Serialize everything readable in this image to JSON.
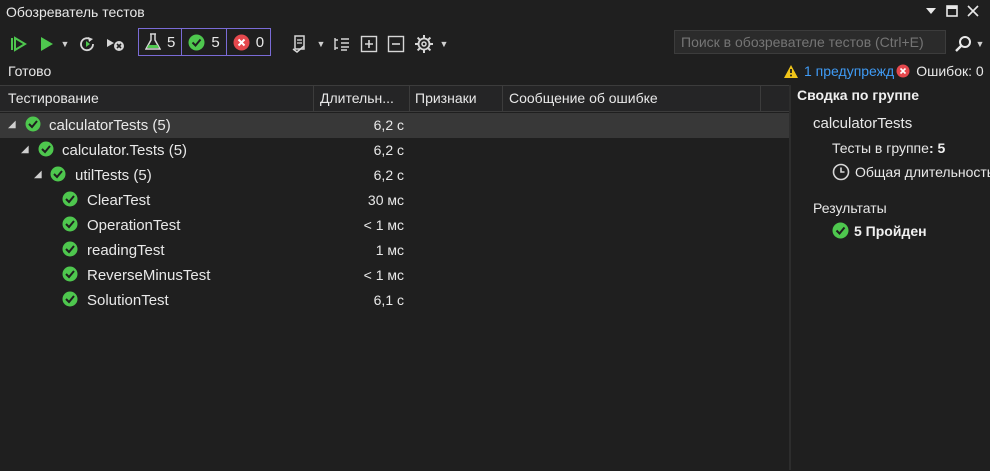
{
  "window": {
    "title": "Обозреватель тестов"
  },
  "toolbar": {
    "counters": {
      "total": "5",
      "passed": "5",
      "failed": "0"
    },
    "search_placeholder": "Поиск в обозревателе тестов (Ctrl+E)"
  },
  "status": {
    "text": "Готово",
    "warnings": "1 предупрежд",
    "errors": "Ошибок: 0"
  },
  "tree": {
    "columns": [
      "Тестирование",
      "Длительн...",
      "Признаки",
      "Сообщение об ошибке"
    ],
    "rows": [
      {
        "name": "calculatorTests  (5)",
        "duration": "6,2 с"
      },
      {
        "name": "calculator.Tests  (5)",
        "duration": "6,2 с"
      },
      {
        "name": "utilTests  (5)",
        "duration": "6,2 с"
      },
      {
        "name": "ClearTest",
        "duration": "30 мс"
      },
      {
        "name": "OperationTest",
        "duration": "< 1 мс"
      },
      {
        "name": "readingTest",
        "duration": "1 мс"
      },
      {
        "name": "ReverseMinusTest",
        "duration": "< 1 мс"
      },
      {
        "name": "SolutionTest",
        "duration": "6,1 с"
      }
    ]
  },
  "summary": {
    "title": "Сводка по группе",
    "group_name": "calculatorTests",
    "count_label": "Тесты в группе",
    "count_value": ": 5",
    "duration_label": "Общая длительность",
    "results_label": "Результаты",
    "passed": "5 Пройден"
  },
  "colors": {
    "pass": "#4ec74e",
    "fail": "#e5484d",
    "warn": "#f0c419",
    "accent": "#7a6bd6",
    "link": "#3f9bf5"
  }
}
